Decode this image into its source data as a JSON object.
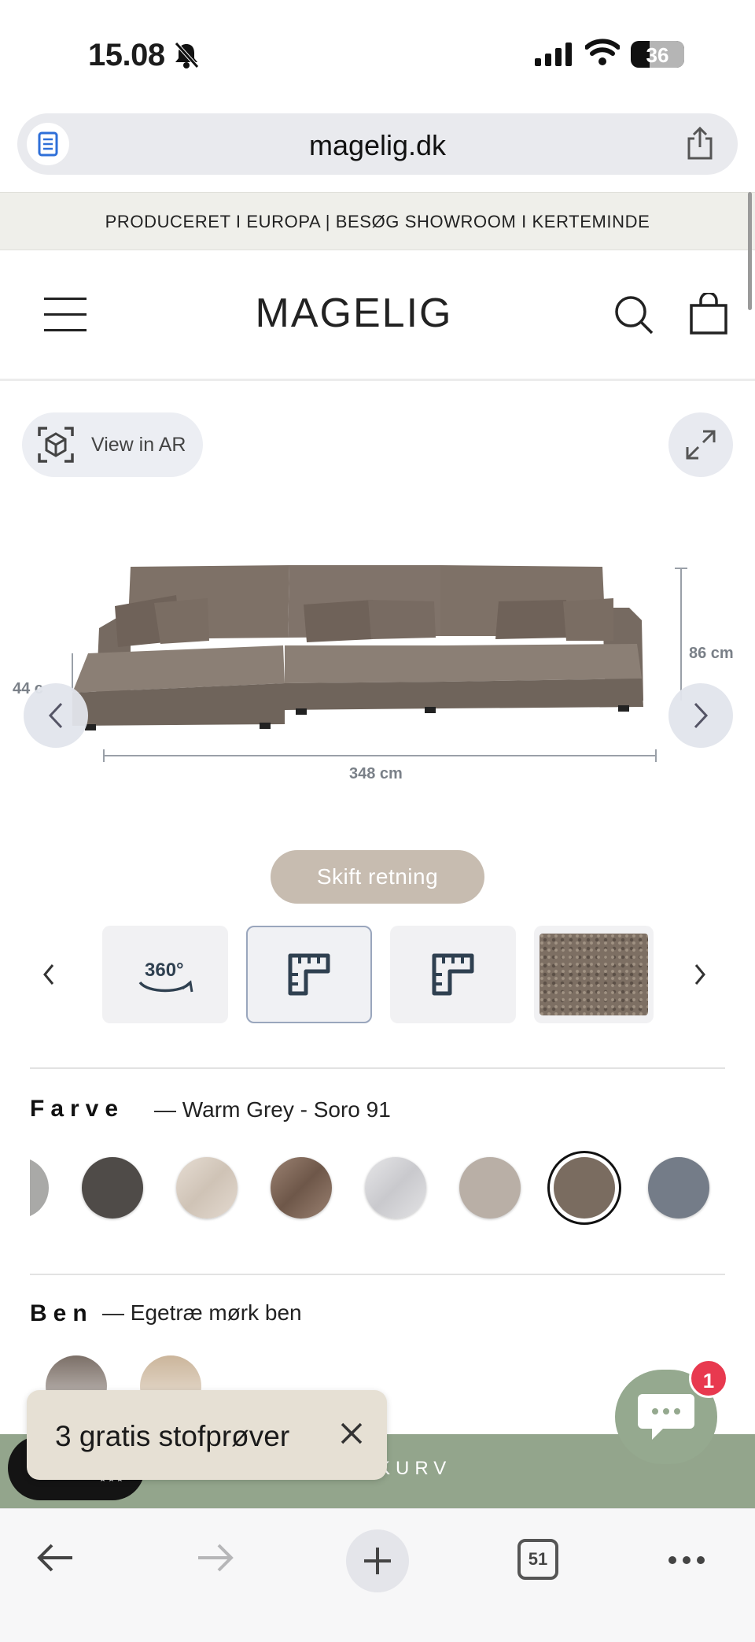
{
  "status_bar": {
    "time": "15.08",
    "battery": "36"
  },
  "browser": {
    "url": "magelig.dk",
    "tab_count": "51"
  },
  "announcement": "PRODUCERET I EUROPA | BESØG SHOWROOM I KERTEMINDE",
  "header": {
    "logo": "MAGELIG"
  },
  "hero": {
    "ar_label": "View in AR",
    "dimension_width": "348 cm",
    "dimension_height": "86 cm",
    "dimension_seat": "44 c",
    "switch_direction_label": "Skift retning"
  },
  "thumbnails": [
    {
      "type": "360",
      "label": "360°"
    },
    {
      "type": "dimension-icon",
      "selected": true
    },
    {
      "type": "dimension-icon",
      "selected": false
    },
    {
      "type": "fabric-sample"
    }
  ],
  "color_option": {
    "label": "Farve",
    "value": "— Warm Grey - Soro 91",
    "swatches": [
      {
        "color": "#a9a9a7"
      },
      {
        "color": "#4f4b48"
      },
      {
        "color": "#d9cfc5"
      },
      {
        "color": "#8b7263"
      },
      {
        "color": "#d8d8db"
      },
      {
        "color": "#b9afa6"
      },
      {
        "color": "#7a6c60",
        "selected": true
      },
      {
        "color": "#747c88"
      }
    ]
  },
  "legs_option": {
    "label": "Ben",
    "value": "— Egetræ mørk ben",
    "swatches": [
      {
        "color": "#4b3a2f"
      },
      {
        "color": "#b89a76"
      }
    ]
  },
  "add_to_cart_label": "KURV",
  "toast": {
    "text": "3 gratis stofprøver"
  },
  "chat": {
    "unread": "1"
  },
  "colors": {
    "accent_green": "#93a58c",
    "button_taupe": "#c7bcb0",
    "badge_red": "#e8394f"
  }
}
